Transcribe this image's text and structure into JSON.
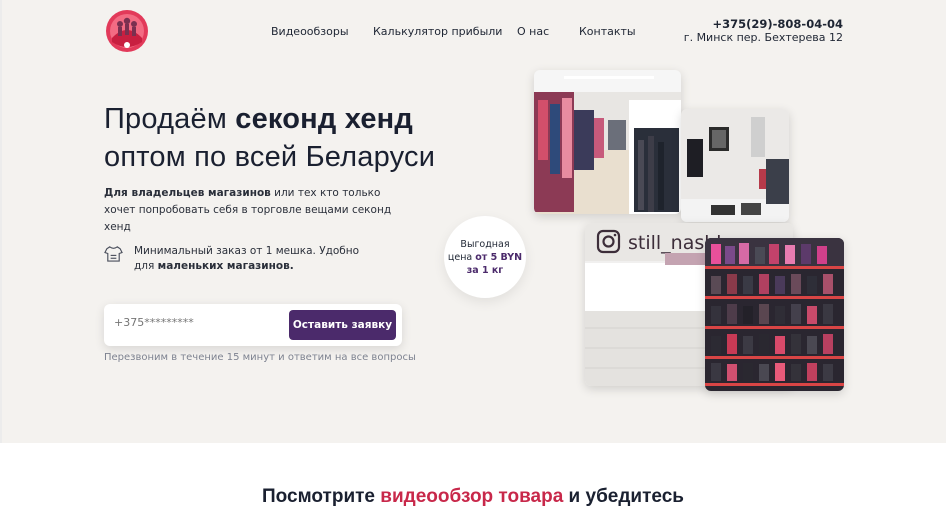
{
  "nav": {
    "items": [
      "Видеообзоры",
      "Калькулятор прибыли",
      "О нас",
      "Контакты"
    ]
  },
  "contact": {
    "phone": "+375(29)-808-04-04",
    "address": "г. Минск пер. Бехтерева 12"
  },
  "hero": {
    "title_line1_regular": "Продаём ",
    "title_line1_bold": "секонд хенд",
    "title_line2": "оптом по всей Беларуси",
    "subtitle_bold": "Для владельцев магазинов",
    "subtitle_rest": " или тех кто только хочет попробовать себя в торговле вещами секонд хенд",
    "feature_text": "Минимальный заказ от 1 мешка. Удобно для ",
    "feature_bold": "маленьких магазинов."
  },
  "form": {
    "phone_placeholder": "+375*********",
    "submit_label": "Оставить заявку",
    "note": "Перезвоним в течение 15 минут и ответим на все вопросы"
  },
  "badge": {
    "line1": "Выгодная",
    "line2_regular": "цена ",
    "line2_bold": "от 5 BYN",
    "line3_bold": "за 1 кг"
  },
  "photos": {
    "shop_sign": "still_nashky"
  },
  "section": {
    "title_start": "Посмотрите ",
    "title_accent": "видеообзор товара",
    "title_end": " и убедитесь"
  },
  "colors": {
    "accent_purple": "#4b2a6b",
    "accent_red": "#c8284a",
    "hero_bg": "#f4f2ef"
  }
}
